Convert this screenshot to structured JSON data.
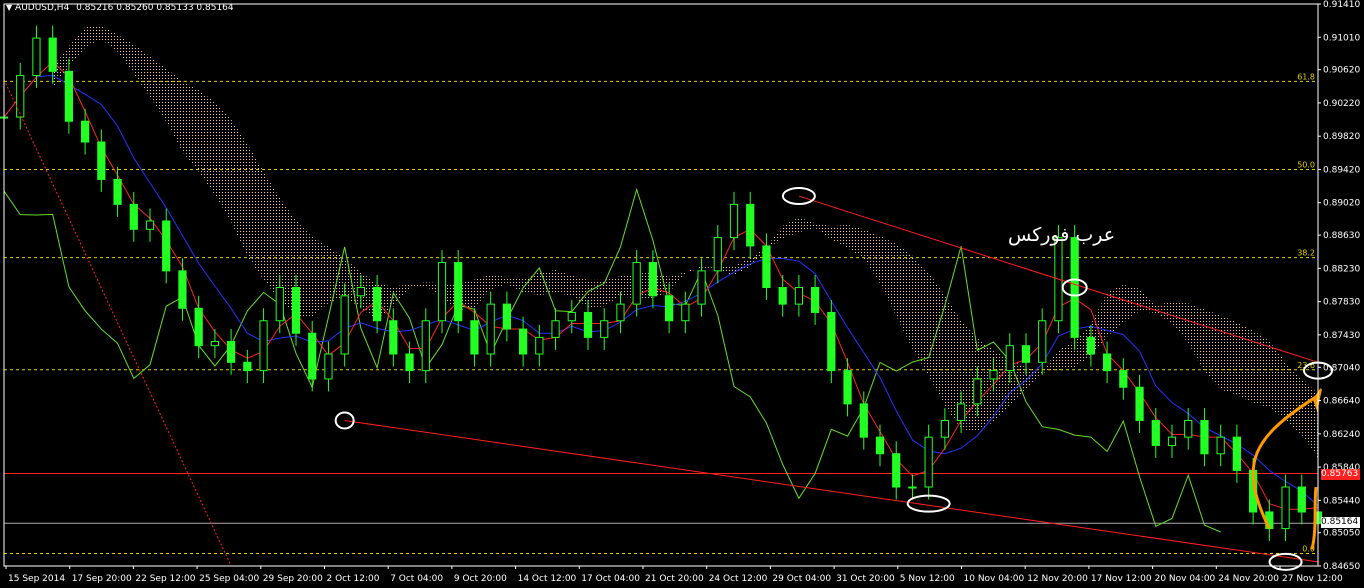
{
  "header": {
    "symbol": "AUDUSD,H4",
    "ohlc": "0.85216 0.85260 0.85133 0.85164"
  },
  "watermark": "عرب فوركس",
  "price_labels": {
    "current": "0.85164",
    "red_line": "0.85763"
  },
  "colors": {
    "background": "#000000",
    "candles": "#22ff22",
    "chikou": "#66dd22",
    "tenkan": "#ff2222",
    "kijun": "#2233ff",
    "cloud": "#f0c8a0",
    "fib_line": "#e0d000",
    "trendline": "#ff2020",
    "annotation": "#ff9900",
    "markers": "#ffffff"
  },
  "chart_data": {
    "type": "candlestick",
    "symbol": "AUDUSD",
    "timeframe": "H4",
    "ylim": [
      0.8465,
      0.9141
    ],
    "y_ticks": [
      "0.91410",
      "0.91010",
      "0.90620",
      "0.90220",
      "0.89820",
      "0.89420",
      "0.89020",
      "0.88630",
      "0.88230",
      "0.87830",
      "0.87430",
      "0.87040",
      "0.86640",
      "0.86240",
      "0.85840",
      "0.85440",
      "0.85050",
      "0.84650"
    ],
    "x_ticks": [
      "15 Sep 2014",
      "17 Sep 20:00",
      "22 Sep 12:00",
      "25 Sep 04:00",
      "29 Sep 20:00",
      "2 Oct 12:00",
      "7 Oct 04:00",
      "9 Oct 20:00",
      "14 Oct 12:00",
      "17 Oct 04:00",
      "21 Oct 20:00",
      "24 Oct 12:00",
      "29 Oct 04:00",
      "31 Oct 20:00",
      "5 Nov 12:00",
      "10 Nov 04:00",
      "12 Nov 20:00",
      "17 Nov 12:00",
      "20 Nov 04:00",
      "24 Nov 20:00",
      "27 Nov 12:00"
    ],
    "fibonacci": [
      {
        "label": "61.8",
        "price": 0.9048
      },
      {
        "label": "50.0",
        "price": 0.8942
      },
      {
        "label": "38.2",
        "price": 0.8836
      },
      {
        "label": "23.6",
        "price": 0.8701
      },
      {
        "label": "0.0",
        "price": 0.848
      }
    ],
    "horizontal_lines": [
      {
        "name": "resistance",
        "price": 0.85763
      },
      {
        "name": "current",
        "price": 0.85164
      }
    ],
    "close_series": [
      [
        0,
        0.9005
      ],
      [
        1,
        0.9055
      ],
      [
        2,
        0.91
      ],
      [
        3,
        0.906
      ],
      [
        4,
        0.9
      ],
      [
        5,
        0.8975
      ],
      [
        6,
        0.893
      ],
      [
        7,
        0.89
      ],
      [
        8,
        0.887
      ],
      [
        9,
        0.888
      ],
      [
        10,
        0.882
      ],
      [
        11,
        0.8775
      ],
      [
        12,
        0.873
      ],
      [
        13,
        0.8735
      ],
      [
        14,
        0.871
      ],
      [
        15,
        0.87
      ],
      [
        16,
        0.876
      ],
      [
        17,
        0.88
      ],
      [
        18,
        0.8745
      ],
      [
        19,
        0.869
      ],
      [
        20,
        0.872
      ],
      [
        21,
        0.879
      ],
      [
        22,
        0.88
      ],
      [
        23,
        0.876
      ],
      [
        24,
        0.872
      ],
      [
        25,
        0.87
      ],
      [
        26,
        0.876
      ],
      [
        27,
        0.883
      ],
      [
        28,
        0.876
      ],
      [
        29,
        0.872
      ],
      [
        30,
        0.878
      ],
      [
        31,
        0.875
      ],
      [
        32,
        0.872
      ],
      [
        33,
        0.874
      ],
      [
        34,
        0.876
      ],
      [
        35,
        0.877
      ],
      [
        36,
        0.874
      ],
      [
        37,
        0.876
      ],
      [
        38,
        0.878
      ],
      [
        39,
        0.883
      ],
      [
        40,
        0.879
      ],
      [
        41,
        0.876
      ],
      [
        42,
        0.878
      ],
      [
        43,
        0.882
      ],
      [
        44,
        0.886
      ],
      [
        45,
        0.89
      ],
      [
        46,
        0.885
      ],
      [
        47,
        0.88
      ],
      [
        48,
        0.878
      ],
      [
        49,
        0.88
      ],
      [
        50,
        0.877
      ],
      [
        51,
        0.87
      ],
      [
        52,
        0.866
      ],
      [
        53,
        0.862
      ],
      [
        54,
        0.86
      ],
      [
        55,
        0.856
      ],
      [
        56,
        0.856
      ],
      [
        57,
        0.862
      ],
      [
        58,
        0.864
      ],
      [
        59,
        0.866
      ],
      [
        60,
        0.869
      ],
      [
        61,
        0.87
      ],
      [
        62,
        0.873
      ],
      [
        63,
        0.871
      ],
      [
        64,
        0.876
      ],
      [
        65,
        0.886
      ],
      [
        66,
        0.874
      ],
      [
        67,
        0.872
      ],
      [
        68,
        0.87
      ],
      [
        69,
        0.868
      ],
      [
        70,
        0.864
      ],
      [
        71,
        0.861
      ],
      [
        72,
        0.862
      ],
      [
        73,
        0.864
      ],
      [
        74,
        0.86
      ],
      [
        75,
        0.862
      ],
      [
        76,
        0.858
      ],
      [
        77,
        0.853
      ],
      [
        78,
        0.851
      ],
      [
        79,
        0.856
      ],
      [
        80,
        0.853
      ],
      [
        81,
        0.8516
      ]
    ],
    "pattern": {
      "type": "descending wedge",
      "upper_trendline": [
        [
          49,
          0.891
        ],
        [
          81,
          0.871
        ]
      ],
      "lower_trendline": [
        [
          21,
          0.864
        ],
        [
          81,
          0.847
        ]
      ]
    }
  }
}
